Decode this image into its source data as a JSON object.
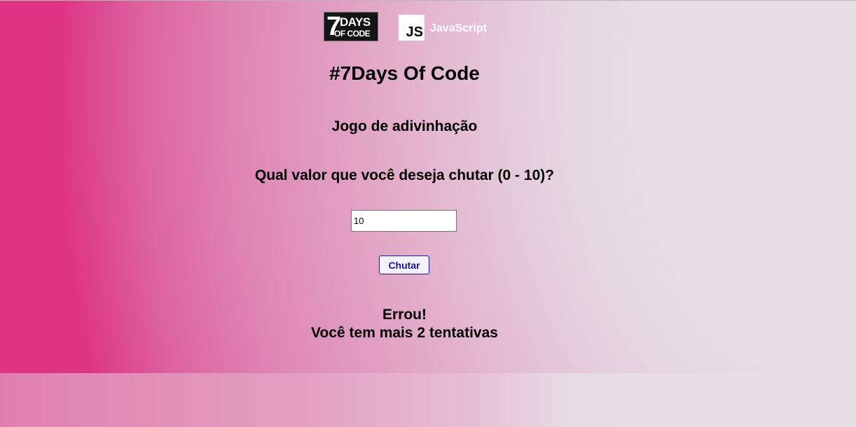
{
  "logos": {
    "seven_days": {
      "seven": "7",
      "days": "DAYS",
      "of_code": "OF CODE"
    },
    "js_badge": "JS",
    "js_name": "JavaScript"
  },
  "page": {
    "title": "#7Days Of Code",
    "subtitle": "Jogo de adivinhação",
    "question": "Qual valor que você deseja chutar (0 - 10)?"
  },
  "form": {
    "guess_value": "10",
    "submit_label": "Chutar"
  },
  "result": {
    "line1": "Errou!",
    "line2": "Você tem mais 2 tentativas"
  },
  "colors": {
    "accent_pink": "#dd3584",
    "button_text": "#1d12a6"
  }
}
